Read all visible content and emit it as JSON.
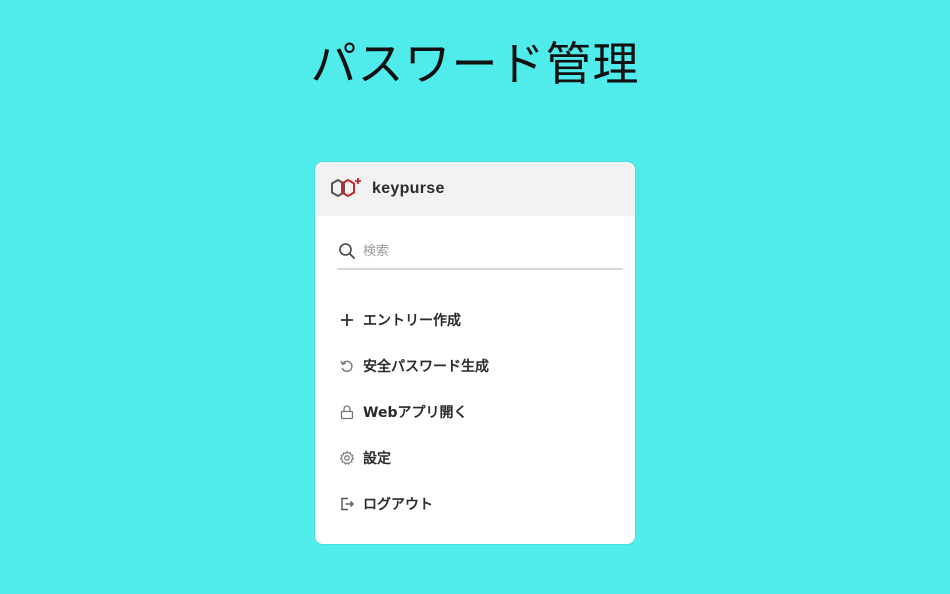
{
  "headline": "パスワード管理",
  "app": {
    "brand": "keypurse",
    "logo_icon": "keypurse-hexagon-logo",
    "accent": "#c62828"
  },
  "search": {
    "placeholder": "検索",
    "icon": "search-icon"
  },
  "menu": {
    "items": [
      {
        "label": "エントリー作成",
        "icon": "plus-icon"
      },
      {
        "label": "安全パスワード生成",
        "icon": "refresh-icon"
      },
      {
        "label": "Webアプリ開く",
        "icon": "lock-icon"
      },
      {
        "label": "設定",
        "icon": "gear-icon"
      },
      {
        "label": "ログアウト",
        "icon": "logout-icon"
      }
    ]
  },
  "colors": {
    "background": "#50ecec",
    "header_bg": "#f2f2f2",
    "text": "#2a2a2a"
  }
}
